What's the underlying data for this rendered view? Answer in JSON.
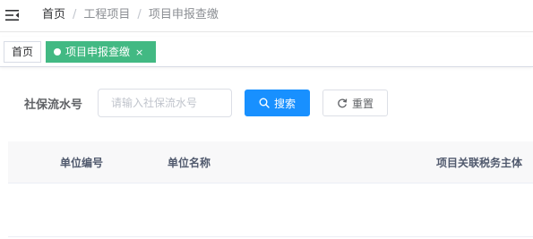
{
  "breadcrumb": {
    "items": [
      "首页",
      "工程项目",
      "项目申报查缴"
    ],
    "separator": "/"
  },
  "tags": {
    "home": "首页",
    "active": "项目申报查缴",
    "close_glyph": "×",
    "active_color": "#42b983"
  },
  "search": {
    "label": "社保流水号",
    "placeholder": "请输入社保流水号",
    "value": "",
    "search_button": "搜索",
    "reset_button": "重置",
    "primary_color": "#1890ff"
  },
  "table": {
    "columns": [
      "单位编号",
      "单位名称",
      "项目关联税务主体"
    ],
    "rows": []
  },
  "icons": {
    "menu": "hamburger-fold-icon",
    "search": "search-icon",
    "reset": "refresh-icon"
  }
}
